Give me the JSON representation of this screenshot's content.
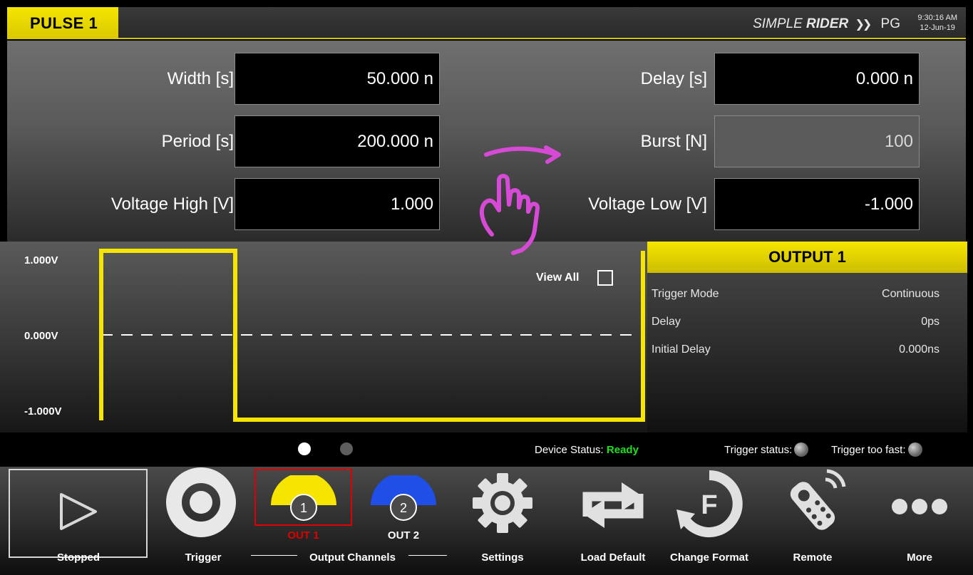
{
  "header": {
    "title": "PULSE 1",
    "brand_simple": "SIMPLE",
    "brand_rider": "RIDER",
    "brand_arrows": "❯❯",
    "brand_suffix": "PG",
    "time": "9:30:16 AM",
    "date": "12-Jun-19"
  },
  "params": {
    "width_label": "Width [s]",
    "width_value": "50.000 n",
    "delay_label": "Delay [s]",
    "delay_value": "0.000 n",
    "period_label": "Period [s]",
    "period_value": "200.000 n",
    "burst_label": "Burst [N]",
    "burst_value": "100",
    "vhigh_label": "Voltage High [V]",
    "vhigh_value": "1.000",
    "vlow_label": "Voltage Low [V]",
    "vlow_value": "-1.000"
  },
  "waveform": {
    "y_top": "1.000V",
    "y_mid": "0.000V",
    "y_bottom": "-1.000V",
    "view_all": "View All",
    "trace_color": "#f5e500"
  },
  "output": {
    "title": "OUTPUT 1",
    "rows": [
      {
        "key": "Trigger Mode",
        "value": "Continuous"
      },
      {
        "key": "Delay",
        "value": "0ps"
      },
      {
        "key": "Initial Delay",
        "value": "0.000ns"
      }
    ]
  },
  "status": {
    "device_label": "Device Status:",
    "device_value": "Ready",
    "trigger_status": "Trigger status:",
    "trigger_too_fast": "Trigger too fast:"
  },
  "toolbar": {
    "stopped": "Stopped",
    "trigger": "Trigger",
    "out1": "OUT 1",
    "out1_num": "1",
    "out2": "OUT 2",
    "out2_num": "2",
    "output_channels": "Output Channels",
    "settings": "Settings",
    "load_default": "Load Default",
    "change_format": "Change Format",
    "remote": "Remote",
    "more": "More"
  },
  "colors": {
    "accent_yellow": "#f5e500",
    "out2_blue": "#1f4fe6",
    "selected_red": "#e00000",
    "ready_green": "#1ee01e",
    "gesture_magenta": "#d64ad6"
  }
}
